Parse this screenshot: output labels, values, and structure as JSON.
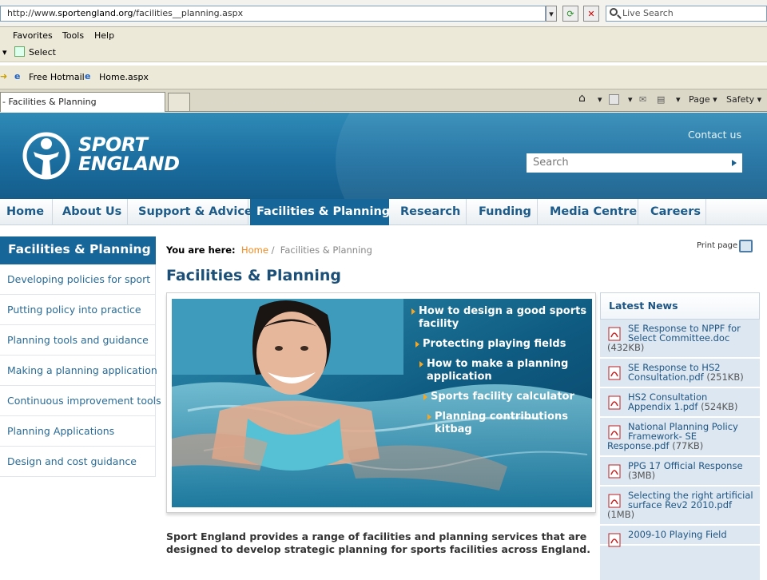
{
  "browser": {
    "address_url": "http://www.sportengland.org/facilities__planning.aspx",
    "address_prefix": "http://www.",
    "address_domain": "sportengland.org",
    "address_path": "/facilities__planning.aspx",
    "search_placeholder": "Live Search",
    "menu": [
      "Favorites",
      "Tools",
      "Help"
    ],
    "select_label": "Select",
    "favorites": [
      "Free Hotmail",
      "Home.aspx"
    ],
    "tab_title": "- Facilities & Planning",
    "toolbar": {
      "page_label": "Page",
      "safety_label": "Safety"
    }
  },
  "site": {
    "logo_line1": "SPORT",
    "logo_line2": "ENGLAND",
    "contact": "Contact us",
    "search_placeholder": "Search",
    "nav": [
      "Home",
      "About Us",
      "Support & Advice",
      "Facilities & Planning",
      "Research",
      "Funding",
      "Media Centre",
      "Careers"
    ],
    "active_nav": "Facilities & Planning"
  },
  "sidebar": {
    "title": "Facilities & Planning",
    "items": [
      "Developing policies for sport",
      "Putting policy into practice",
      "Planning tools and guidance",
      "Making a planning application",
      "Continuous improvement tools",
      "Planning Applications",
      "Design and cost guidance"
    ]
  },
  "main": {
    "breadcrumb_label": "You are here:",
    "breadcrumb_home": "Home",
    "breadcrumb_sep": "/",
    "breadcrumb_current": "Facilities & Planning",
    "print_label": "Print page",
    "title": "Facilities & Planning",
    "hero_links": [
      "How to design a good sports facility",
      "Protecting playing fields",
      "How to make a planning application",
      "Sports facility calculator",
      "Planning contributions kitbag"
    ],
    "intro": "Sport England provides a range of facilities and planning services that are designed to develop strategic planning for sports facilities across England."
  },
  "news": {
    "title": "Latest News",
    "items": [
      {
        "title": "SE Response to NPPF for Select Committee.doc",
        "size": "(432KB)"
      },
      {
        "title": "SE Response to HS2 Consultation.pdf",
        "size": "(251KB)"
      },
      {
        "title": "HS2 Consultation Appendix 1.pdf",
        "size": "(524KB)"
      },
      {
        "title": "National Planning Policy Framework- SE Response.pdf",
        "size": "(77KB)"
      },
      {
        "title": "PPG 17 Official Response",
        "size": "(3MB)"
      },
      {
        "title": "Selecting the right artificial surface Rev2 2010.pdf",
        "size": "(1MB)"
      },
      {
        "title": "2009-10 Playing Field",
        "size": ""
      }
    ]
  },
  "colors": {
    "brand_blue": "#17669a",
    "link_blue": "#2a6b96",
    "accent_orange": "#f08a1d"
  }
}
